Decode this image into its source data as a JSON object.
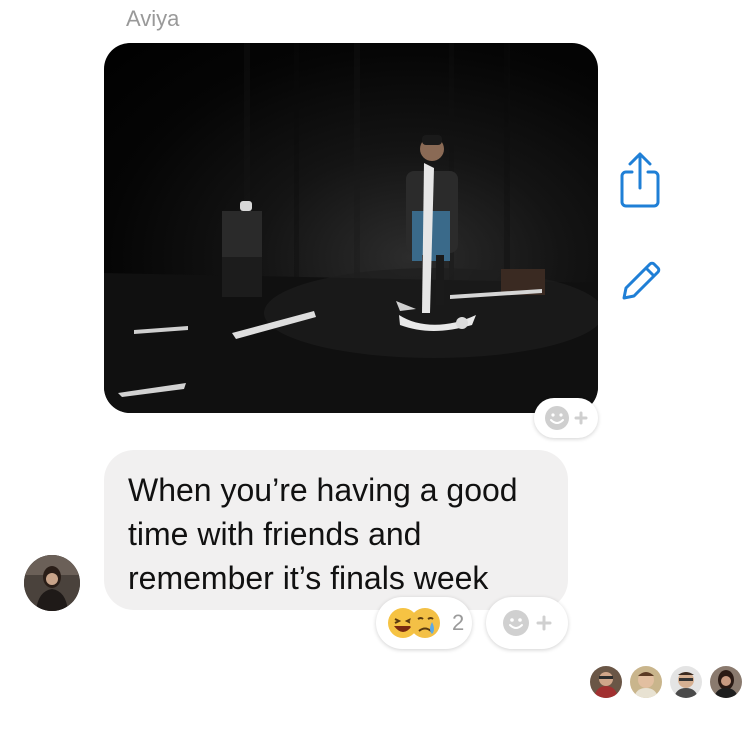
{
  "conversation": {
    "sender_name": "Aviya",
    "photo_message": {
      "alt": "Performer on a dark stage draped in toilet paper"
    },
    "text_message": {
      "lines": [
        "When you’re having a good",
        "time with friends and",
        "remember it’s finals week"
      ]
    },
    "reactions": {
      "emojis": [
        "laughing-face",
        "crying-face"
      ],
      "count": "2"
    },
    "read_receipts": [
      "reader-1",
      "reader-2",
      "reader-3",
      "reader-4"
    ]
  },
  "actions": {
    "share_icon": "share-icon",
    "edit_icon": "edit-icon",
    "add_reaction_icon": "smiley-plus-icon"
  },
  "colors": {
    "accent": "#1f7fd6",
    "bubble": "#f1f0f0",
    "muted_text": "#999999"
  }
}
